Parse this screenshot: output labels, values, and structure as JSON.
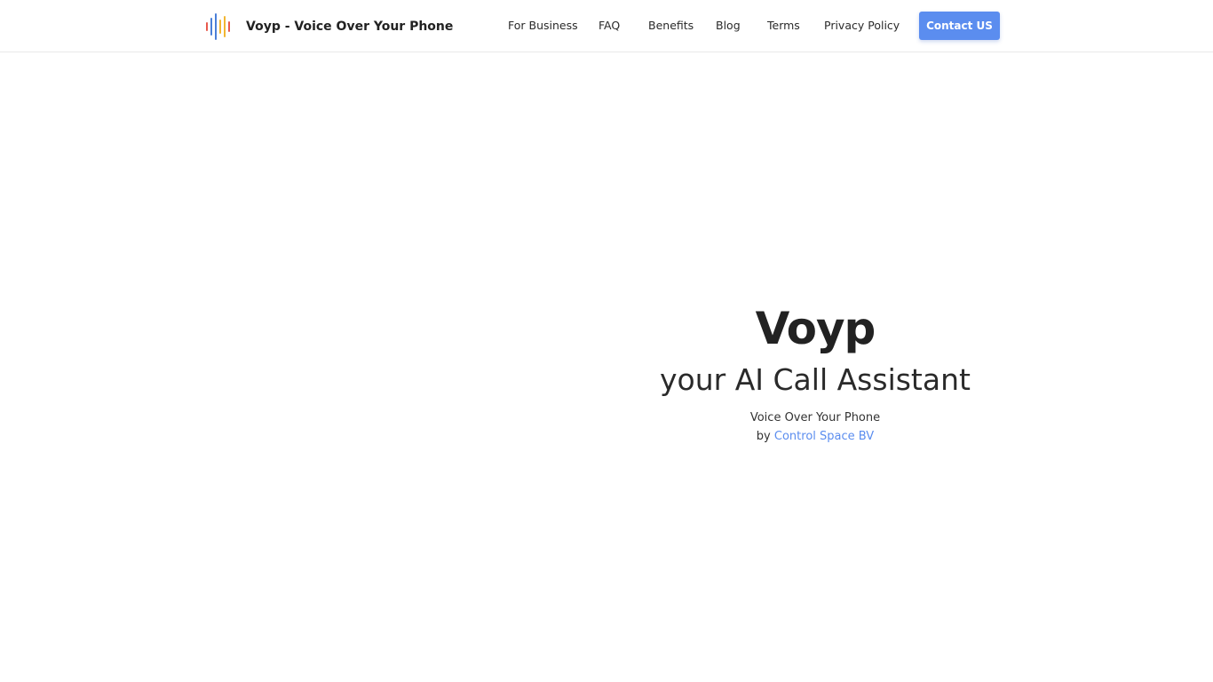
{
  "header": {
    "brand_title": "Voyp - Voice Over Your Phone",
    "logo_icon": "sound-wave-icon",
    "nav": [
      {
        "label": "For Business"
      },
      {
        "label": "FAQ"
      },
      {
        "label": "Benefits"
      },
      {
        "label": "Blog"
      },
      {
        "label": "Terms"
      },
      {
        "label": "Privacy Policy"
      }
    ],
    "contact_label": "Contact US"
  },
  "hero": {
    "title": "Voyp",
    "subtitle": "your AI Call Assistant",
    "tagline": "Voice Over Your Phone",
    "by_prefix": "by",
    "company_link": "Control Space BV"
  },
  "colors": {
    "accent": "#5b8def",
    "logo_bars": [
      "#e8594c",
      "#4a7fd8",
      "#4a7fd8",
      "#f2b632",
      "#f2b632",
      "#e8594c"
    ]
  }
}
